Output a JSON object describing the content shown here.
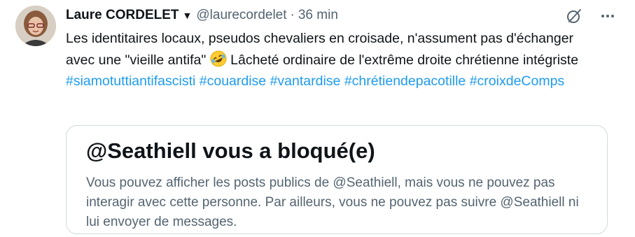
{
  "author": {
    "name": "Laure CORDELET",
    "caret": "▼",
    "handle": "@laurecordelet",
    "separator": "·",
    "time": "36 min"
  },
  "icons": {
    "avatar": "avatar-photo",
    "grok": "grok-slash-circle-icon",
    "more": "more-horizontal-icon",
    "emoji": "rolling-on-floor-laughing-emoji"
  },
  "tweet": {
    "text_part1": "Les identitaires locaux, pseudos chevaliers en croisade, n'assument pas d'échanger avec une \"vieille antifa\" ",
    "text_part2": " Lâcheté ordinaire de l'extrême droite chrétienne intégriste ",
    "hashtags": [
      "#siamotuttiantifascisti",
      "#couardise",
      "#vantardise",
      "#chrétiendepacotille",
      "#croixdeComps"
    ]
  },
  "blocked_notice": {
    "title": "@Seathiell vous a bloqué(e)",
    "description": "Vous pouvez afficher les posts publics de @Seathiell, mais vous ne pouvez pas interagir avec cette personne. Par ailleurs, vous ne pouvez pas suivre @Seathiell ni lui envoyer de messages."
  },
  "colors": {
    "text": "#0f1419",
    "secondary": "#536471",
    "link": "#1d9bf0",
    "border": "#cfd9de"
  }
}
